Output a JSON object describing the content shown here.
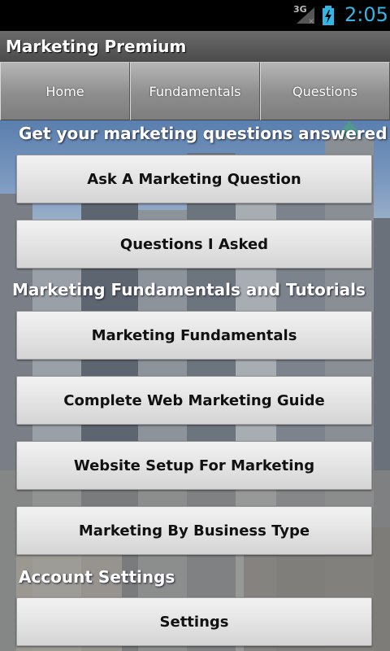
{
  "status_bar": {
    "network": "3G",
    "time": "2:05",
    "time_color": "#33b5e5"
  },
  "app": {
    "title": "Marketing Premium"
  },
  "tabs": [
    {
      "label": "Home"
    },
    {
      "label": "Fundamentals"
    },
    {
      "label": "Questions"
    }
  ],
  "sections": [
    {
      "heading": "Get your marketing questions answered",
      "buttons": [
        "Ask A Marketing Question",
        "Questions I Asked"
      ]
    },
    {
      "heading": "Marketing Fundamentals and Tutorials",
      "buttons": [
        "Marketing Fundamentals",
        "Complete Web Marketing Guide",
        "Website Setup For Marketing",
        "Marketing By Business Type"
      ]
    },
    {
      "heading": "Account Settings",
      "buttons": [
        "Settings"
      ]
    }
  ]
}
